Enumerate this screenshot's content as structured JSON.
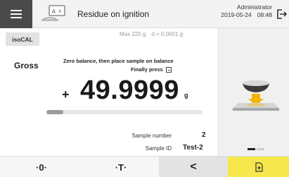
{
  "header": {
    "app_title": "Residue on ignition",
    "user": "Administrator",
    "date": "2019-05-24",
    "time": "08:48",
    "menu_icon": "hamburger-menu-icon",
    "app_icon": "delta-weighing-icon",
    "logout_icon": "logout-icon"
  },
  "left": {
    "isocal_label": "isoCAL",
    "max_capacity": "Max 220 g",
    "readability": "d = 0.0001 g",
    "mode_label": "Gross",
    "instruction_line1": "Zero balance, then place sample on balance",
    "instruction_line2": "Finally press",
    "sign": "+",
    "weight_value": "49.9999",
    "unit": "g",
    "progress_fraction": 0.11,
    "sample_number_label": "Sample number",
    "sample_number_value": "2",
    "sample_id_label": "Sample ID",
    "sample_id_value": "Test-2"
  },
  "right": {
    "illustration": "place-sample-on-balance-illustration",
    "pager_pages": 2,
    "pager_active": 0
  },
  "bottom": {
    "zero_label": "·0·",
    "tare_label": "·T·",
    "back_label": "<",
    "ok_icon": "accept-document-icon"
  },
  "colors": {
    "header_bg": "#f3f3f3",
    "menu_bg": "#4a4a4a",
    "accent_yellow": "#f6e84c",
    "arrow_orange": "#f5b400"
  }
}
